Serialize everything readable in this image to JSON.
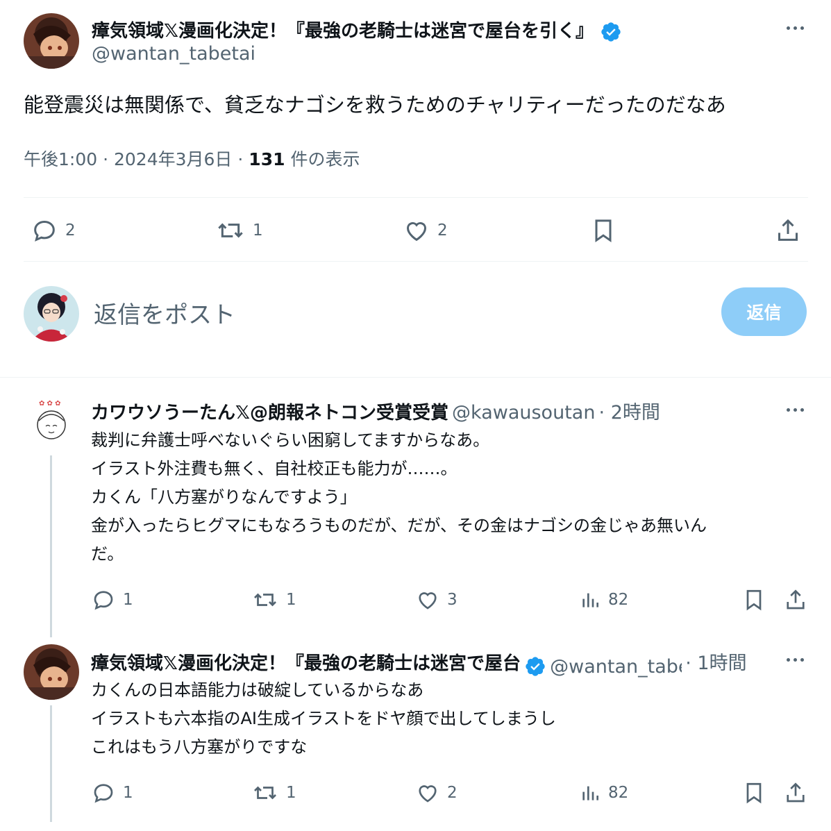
{
  "main_tweet": {
    "display_name": "瘴気領域𝕏漫画化決定！『最強の老騎士は迷宮で屋台を引く』",
    "handle": "@wantan_tabetai",
    "text": "能登震災は無関係で、貧乏なナゴシを救うためのチャリティーだったのだなあ",
    "time": "午後1:00",
    "date": "2024年3月6日",
    "view_count": "131",
    "view_label": "件の表示",
    "separator": "·",
    "actions": {
      "replies": "2",
      "reposts": "1",
      "likes": "2"
    }
  },
  "composer": {
    "placeholder": "返信をポスト",
    "button_label": "返信"
  },
  "replies": [
    {
      "display_name": "カワウソうーたん𝕏@朗報ネトコン受賞受賞",
      "handle": "@kawausoutan",
      "time": "· 2時間",
      "lines": [
        "裁判に弁護士呼べないぐらい困窮してますからなあ。",
        "イラスト外注費も無く、自社校正も能力が……。",
        "カくん「八方塞がりなんですよう」",
        "金が入ったらヒグマにもなろうものだが、だが、その金はナゴシの金じゃあ無いん",
        "だ。"
      ],
      "actions": {
        "replies": "1",
        "reposts": "1",
        "likes": "3",
        "views": "82"
      }
    },
    {
      "display_name": "瘴気領域𝕏漫画化決定！『最強の老騎士は迷宮で屋台",
      "handle": "@wantan_tabe",
      "time": "· 1時間",
      "lines": [
        "カくんの日本語能力は破綻しているからなあ",
        "イラストも六本指のAI生成イラストをドヤ顔で出してしまうし",
        "これはもう八方塞がりですな"
      ],
      "actions": {
        "replies": "1",
        "reposts": "1",
        "likes": "2",
        "views": "82"
      }
    }
  ],
  "colors": {
    "verified": "#1d9bf0",
    "reply_button": "#8ecdf8",
    "secondary": "#536471"
  }
}
